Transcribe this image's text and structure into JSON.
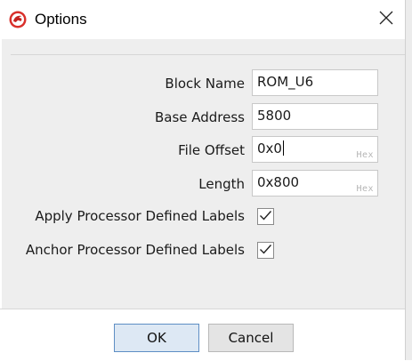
{
  "dialog": {
    "title": "Options",
    "icon": "ghidra-dragon-icon",
    "close_icon": "close-icon"
  },
  "form": {
    "block_name": {
      "label": "Block Name",
      "value": "ROM_U6"
    },
    "base_address": {
      "label": "Base Address",
      "value": "5800"
    },
    "file_offset": {
      "label": "File Offset",
      "value": "0x0",
      "badge": "Hex"
    },
    "length": {
      "label": "Length",
      "value": "0x800",
      "badge": "Hex"
    },
    "apply_labels": {
      "label": "Apply Processor Defined Labels",
      "checked": true
    },
    "anchor_labels": {
      "label": "Anchor Processor Defined Labels",
      "checked": true
    }
  },
  "buttons": {
    "ok": "OK",
    "cancel": "Cancel"
  },
  "colors": {
    "accent_red": "#d9302b",
    "content_bg": "#eeeeee",
    "ok_border": "#5e8ec4"
  }
}
